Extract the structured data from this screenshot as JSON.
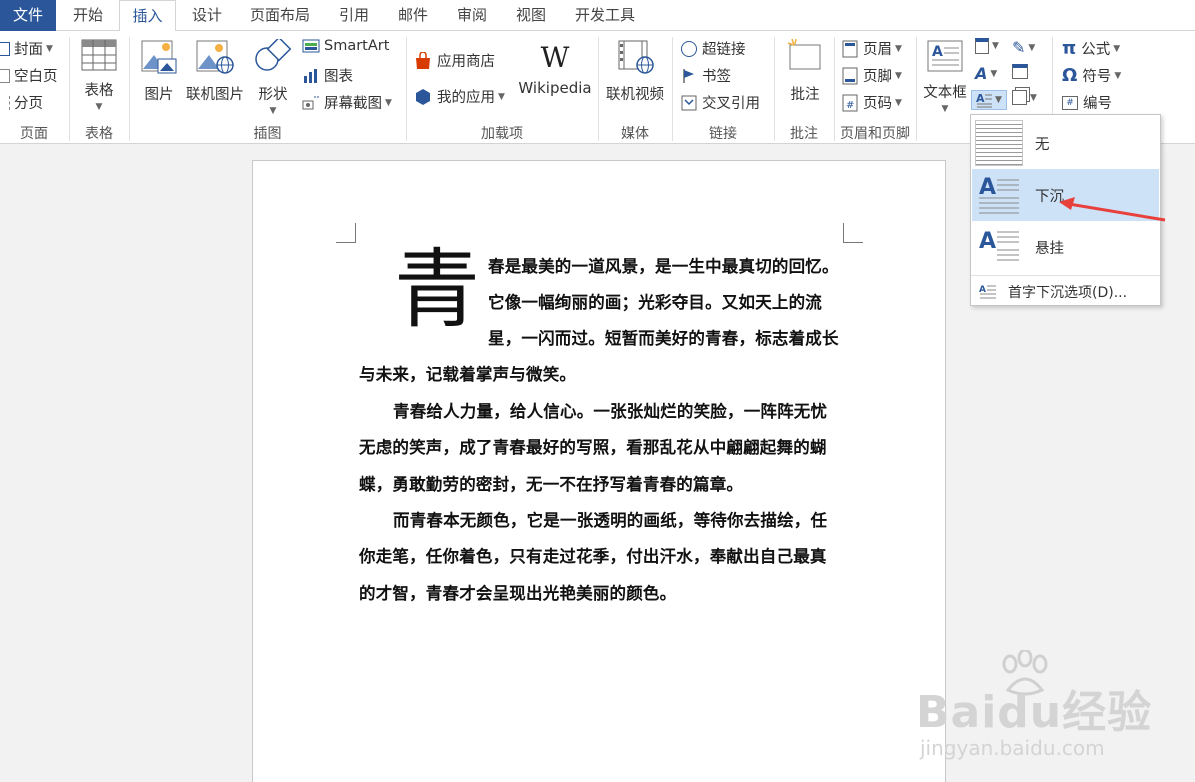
{
  "tabs": [
    "文件",
    "开始",
    "插入",
    "设计",
    "页面布局",
    "引用",
    "邮件",
    "审阅",
    "视图",
    "开发工具"
  ],
  "ribbon": {
    "page_group": {
      "label": "页面",
      "items": [
        "封面",
        "空白页",
        "分页"
      ]
    },
    "table_group": {
      "label": "表格",
      "item": "表格"
    },
    "illustrations_group": {
      "label": "插图",
      "picture": "图片",
      "online_picture": "联机图片",
      "shapes": "形状",
      "smartart": "SmartArt",
      "chart": "图表",
      "screenshot": "屏幕截图"
    },
    "addins_group": {
      "label": "加载项",
      "store": "应用商店",
      "my_apps": "我的应用",
      "wikipedia": "Wikipedia"
    },
    "media_group": {
      "label": "媒体",
      "online_video": "联机视频"
    },
    "links_group": {
      "label": "链接",
      "hyperlink": "超链接",
      "bookmark": "书签",
      "cross_ref": "交叉引用"
    },
    "comments_group": {
      "label": "批注",
      "comment": "批注"
    },
    "header_footer_group": {
      "label": "页眉和页脚",
      "header": "页眉",
      "footer": "页脚",
      "page_number": "页码"
    },
    "text_group": {
      "textbox": "文本框"
    },
    "symbols_group": {
      "equation": "公式",
      "symbol": "符号",
      "number": "编号"
    }
  },
  "dropcap_menu": {
    "items": [
      "无",
      "下沉",
      "悬挂"
    ],
    "selected": "下沉",
    "options_label": "首字下沉选项(D)..."
  },
  "document": {
    "dropcap_char": "青",
    "lines": [
      "春是最美的一道风景，是一生中最真切的回忆。",
      "它像一幅绚丽的画；光彩夺目。又如天上的流",
      "星，一闪而过。短暂而美好的青春，标志着成长",
      "与未来，记载着掌声与微笑。",
      "青春给人力量，给人信心。一张张灿烂的笑脸，一阵阵无忧",
      "无虑的笑声，成了青春最好的写照，看那乱花从中翩翩起舞的蝴",
      "蝶，勇敢勤劳的密封，无一不在抒写着青春的篇章。",
      "而青春本无颜色，它是一张透明的画纸，等待你去描绘，任",
      "你走笔，任你着色，只有走过花季，付出汗水，奉献出自己最真",
      "的才智，青春才会呈现出光艳美丽的颜色。"
    ]
  },
  "watermark": {
    "brand": "Baidu经验",
    "url": "jingyan.baidu.com"
  },
  "colors": {
    "accent": "#2b579a",
    "highlight": "#cde1f7",
    "arrow": "#e8413c"
  }
}
